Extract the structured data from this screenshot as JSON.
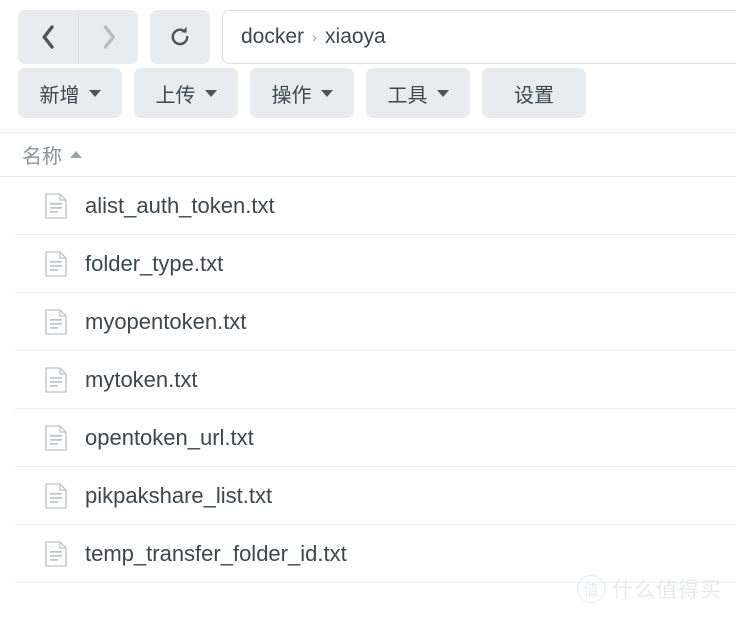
{
  "nav": {
    "back_icon": "chevron-left-icon",
    "back_label": "后退",
    "forward_icon": "chevron-right-icon",
    "forward_label": "前进",
    "refresh_icon": "refresh-icon",
    "refresh_label": "刷新",
    "breadcrumb": {
      "separator": "›",
      "items": [
        {
          "label": "docker"
        },
        {
          "label": "xiaoya"
        }
      ]
    }
  },
  "toolbar": {
    "buttons": [
      {
        "label": "新增",
        "has_caret": true
      },
      {
        "label": "上传",
        "has_caret": true
      },
      {
        "label": "操作",
        "has_caret": true
      },
      {
        "label": "工具",
        "has_caret": true
      },
      {
        "label": "设置",
        "has_caret": false
      }
    ]
  },
  "list": {
    "columns": [
      {
        "label": "名称",
        "sort": "asc"
      }
    ],
    "rows": [
      {
        "name": "alist_auth_token.txt",
        "icon": "file-text-icon"
      },
      {
        "name": "folder_type.txt",
        "icon": "file-text-icon"
      },
      {
        "name": "myopentoken.txt",
        "icon": "file-text-icon"
      },
      {
        "name": "mytoken.txt",
        "icon": "file-text-icon"
      },
      {
        "name": "opentoken_url.txt",
        "icon": "file-text-icon"
      },
      {
        "name": "pikpakshare_list.txt",
        "icon": "file-text-icon"
      },
      {
        "name": "temp_transfer_folder_id.txt",
        "icon": "file-text-icon"
      }
    ]
  },
  "watermark": {
    "badge": "值",
    "text": "什么值得买"
  },
  "colors": {
    "button_bg": "#e8ecf0",
    "text_primary": "#3c4750",
    "text_muted": "#8a949d",
    "divider": "#eceff2",
    "page_bg": "#ffffff"
  }
}
